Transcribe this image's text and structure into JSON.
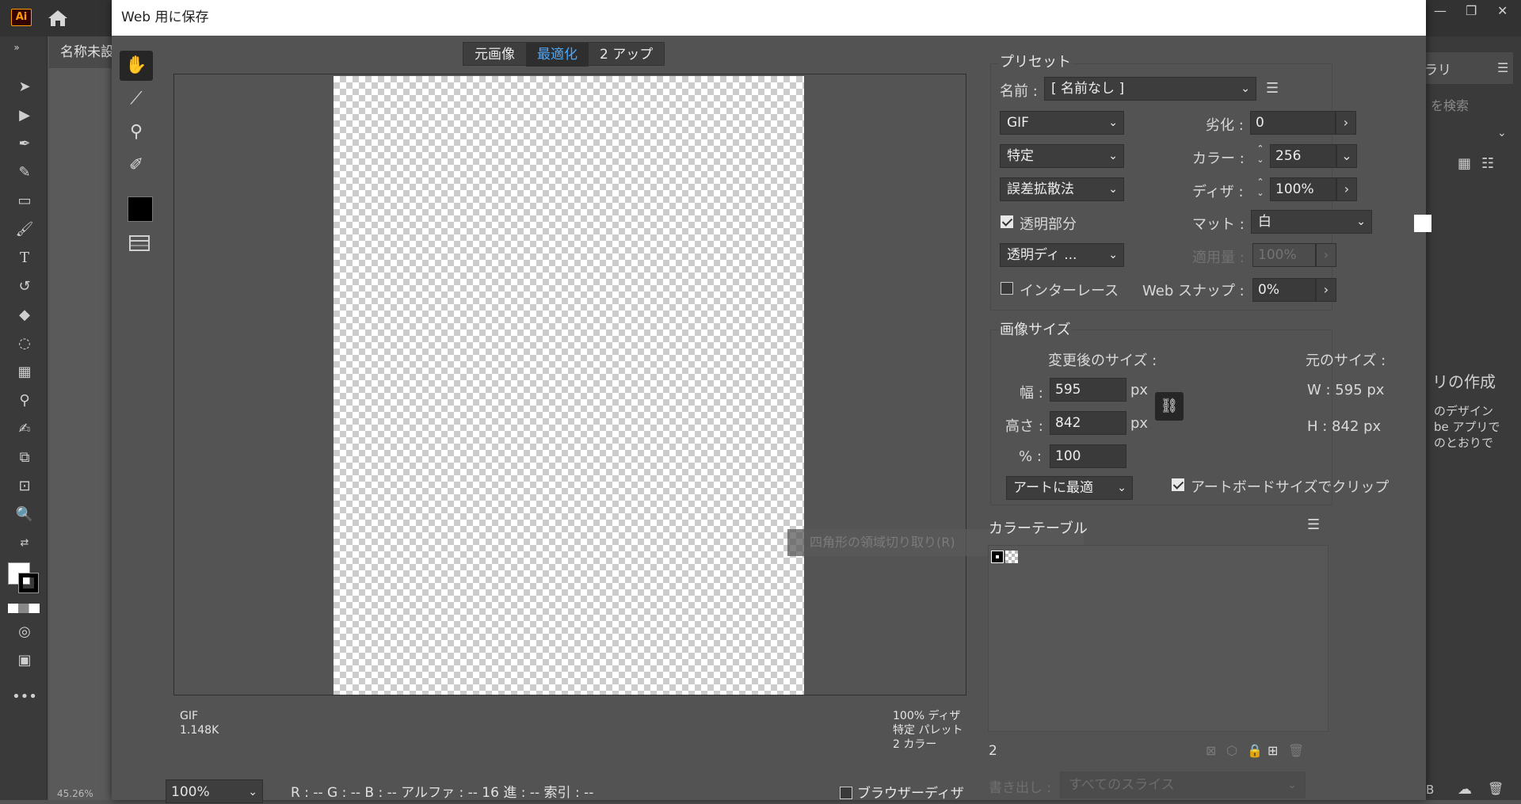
{
  "app": {
    "logo": "Ai",
    "document_tab": "名称未設",
    "zoom_status": "45.26%",
    "window_controls": [
      "—",
      "❐",
      "✕"
    ]
  },
  "right_panel": {
    "tab_fragment": "ラリ",
    "search_fragment": "を検索",
    "create_fragment": "リの作成",
    "desc_lines": [
      "のデザイン",
      "be アプリで",
      "のとおりで"
    ],
    "bottom_fragment": "B"
  },
  "dialog": {
    "title": "Web 用に保存",
    "view_tabs": [
      "元画像",
      "最適化",
      "2 アップ"
    ],
    "active_tab_index": 1,
    "preview_info_left": [
      "GIF",
      "1.148K"
    ],
    "preview_info_right": [
      "100% ディザ",
      "特定 パレット",
      "2 カラー"
    ],
    "watermark": "四角形の領域切り取り(R)",
    "zoom": "100%",
    "pixel_readout": "R : --  G : --  B : --  アルファ : --  16 進 : --  索引 : --",
    "browser_dither": "ブラウザーディザ"
  },
  "preset": {
    "section": "プリセット",
    "name_label": "名前 :",
    "name_value": "[ 名前なし ]",
    "format": "GIF",
    "palette": "特定",
    "dither_algorithm": "誤差拡散法",
    "transparency_dither": "透明ディ ...",
    "lossy_label": "劣化 :",
    "lossy_value": "0",
    "colors_label": "カラー :",
    "colors_value": "256",
    "dither_label": "ディザ :",
    "dither_value": "100%",
    "transparency_label": "透明部分",
    "transparency_checked": true,
    "matte_label": "マット :",
    "matte_value": "白",
    "amount_label": "適用量 :",
    "amount_value": "100%",
    "interlaced_label": "インターレース",
    "interlaced_checked": false,
    "websnap_label": "Web スナップ :",
    "websnap_value": "0%"
  },
  "image_size": {
    "section": "画像サイズ",
    "new_size_label": "変更後のサイズ :",
    "original_size_label": "元のサイズ :",
    "width_label": "幅 :",
    "width_value": "595",
    "height_label": "高さ :",
    "height_value": "842",
    "percent_label": "% :",
    "percent_value": "100",
    "unit": "px",
    "orig_w": "W :  595 px",
    "orig_h": "H :  842 px",
    "fit_mode": "アートに最適",
    "clip_label": "アートボードサイズでクリップ",
    "clip_checked": true
  },
  "color_table": {
    "section": "カラーテーブル",
    "count": "2",
    "export_label": "書き出し :",
    "export_value": "すべてのスライス"
  },
  "icons": {
    "home": "home-icon",
    "hand": "hand-icon",
    "slice_select": "slice-select-icon",
    "zoom": "zoom-icon",
    "eyedropper": "eyedropper-icon",
    "link": "link-icon",
    "menu": "menu-icon"
  },
  "colors": {
    "accent_tab": "#4aa8ff",
    "dialog_bg": "#535353",
    "titlebar": "#ffffff",
    "ai_orange": "#ff9a00"
  }
}
